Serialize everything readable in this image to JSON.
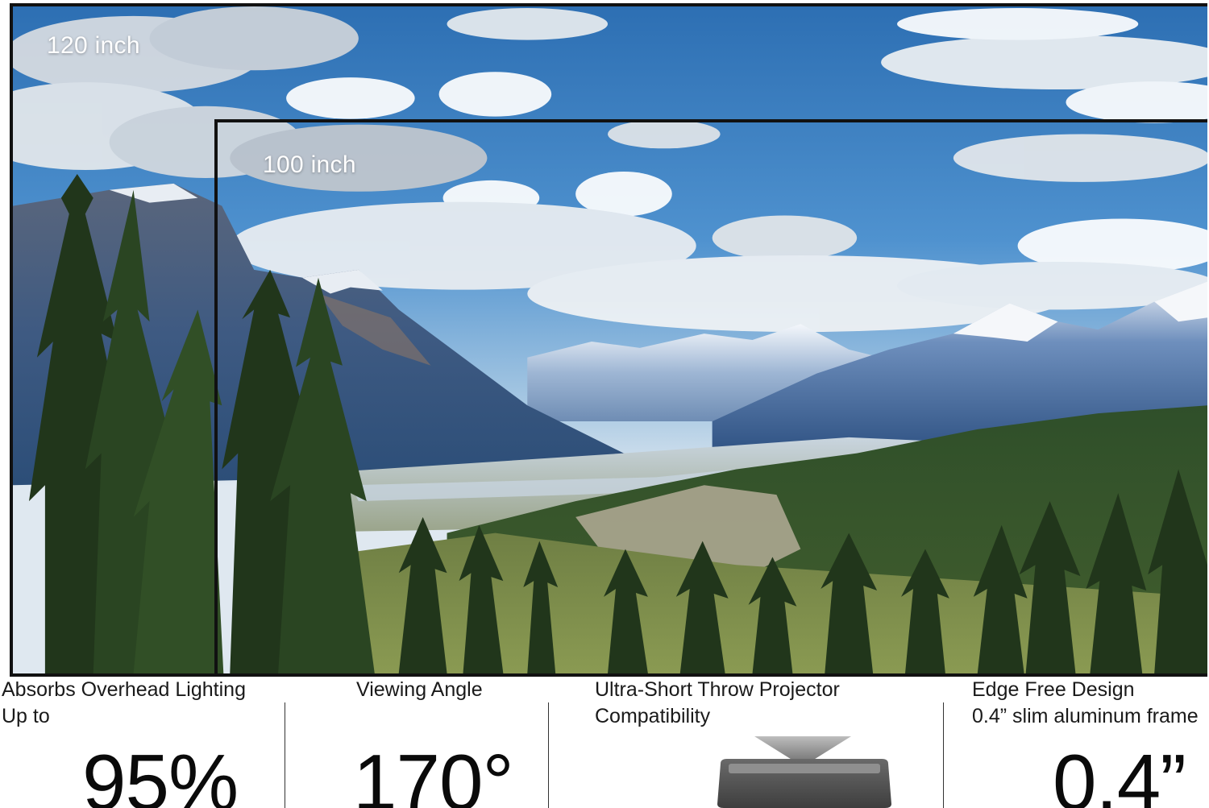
{
  "screens": {
    "outer_label": "120 inch",
    "inner_label": "100 inch"
  },
  "features": [
    {
      "heading_line1": "Absorbs Overhead Lighting",
      "heading_line2": "Up to",
      "value": "95%"
    },
    {
      "heading_line1": "Viewing Angle",
      "value": "170°"
    },
    {
      "heading_line1": "Ultra-Short Throw Projector",
      "heading_line2": "Compatibility",
      "icon": "projector-icon"
    },
    {
      "heading_line1": "Edge Free Design",
      "heading_line2": "0.4” slim aluminum frame",
      "value": "0.4”"
    }
  ],
  "colors": {
    "frame": "#111111",
    "sky": "#3f86c7",
    "forest": "#2f4a22",
    "snow": "#eef2f7"
  }
}
